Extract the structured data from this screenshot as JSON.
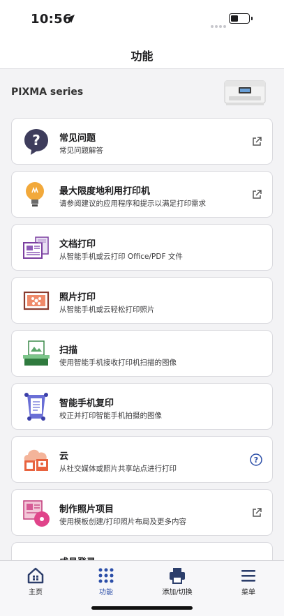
{
  "status": {
    "time": "10:56"
  },
  "header": {
    "title": "功能"
  },
  "printer": {
    "name": "PIXMA series"
  },
  "items": [
    {
      "title": "常见问题",
      "subtitle": "常见问题解答",
      "icon": "help-bubble-icon",
      "action": "external-link-icon"
    },
    {
      "title": "最大限度地利用打印机",
      "subtitle": "请参阅建议的应用程序和提示以满足打印需求",
      "icon": "lightbulb-icon",
      "action": "external-link-icon"
    },
    {
      "title": "文档打印",
      "subtitle": "从智能手机或云打印 Office/PDF 文件",
      "icon": "document-print-icon",
      "action": ""
    },
    {
      "title": "照片打印",
      "subtitle": "从智能手机或云轻松打印照片",
      "icon": "photo-print-icon",
      "action": ""
    },
    {
      "title": "扫描",
      "subtitle": "使用智能手机接收打印机扫描的图像",
      "icon": "scan-icon",
      "action": ""
    },
    {
      "title": "智能手机复印",
      "subtitle": "校正并打印智能手机拍摄的图像",
      "icon": "smartphone-copy-icon",
      "action": ""
    },
    {
      "title": "云",
      "subtitle": "从社交媒体或照片共享站点进行打印",
      "icon": "cloud-print-icon",
      "action": "question-circle-icon"
    },
    {
      "title": "制作照片项目",
      "subtitle": "使用模板创建/打印照片布局及更多内容",
      "icon": "photo-project-icon",
      "action": "external-link-icon"
    },
    {
      "title": "成员登录",
      "subtitle": "",
      "icon": "member-icon",
      "action": "external-link-icon"
    }
  ],
  "tabs": [
    {
      "label": "主页",
      "icon": "home-icon",
      "active": false
    },
    {
      "label": "功能",
      "icon": "grid-dots-icon",
      "active": true
    },
    {
      "label": "添加/切换",
      "icon": "printer-icon",
      "active": false
    },
    {
      "label": "菜单",
      "icon": "hamburger-menu-icon",
      "active": false
    }
  ],
  "colors": {
    "accent": "#2b4ea8",
    "card_border": "#d9d9de",
    "background": "#f3f3f5"
  }
}
